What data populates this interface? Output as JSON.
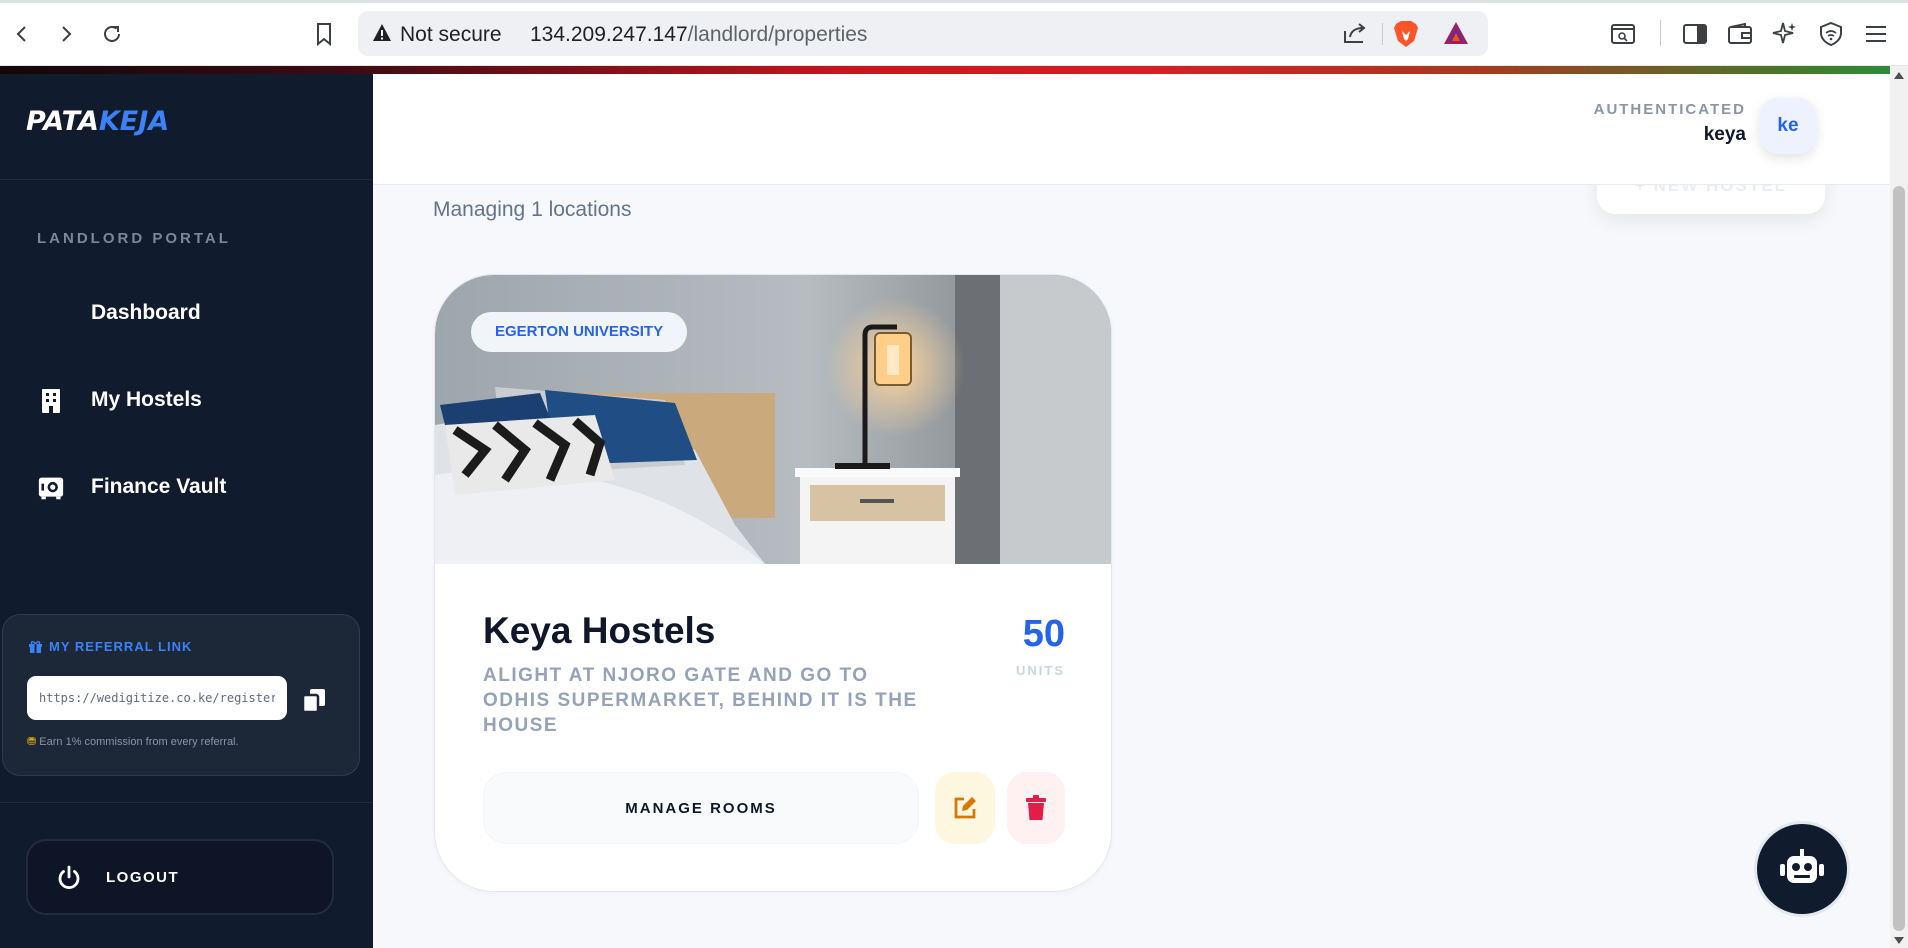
{
  "browser": {
    "security_text": "Not secure",
    "url_host": "134.209.247.147",
    "url_path": "/landlord/properties"
  },
  "sidebar": {
    "logo_part1": "PATA",
    "logo_part2": "KEJA",
    "portal_label": "LANDLORD PORTAL",
    "items": [
      {
        "label": "Dashboard",
        "icon": "dashboard-icon"
      },
      {
        "label": "My Hostels",
        "icon": "building-icon"
      },
      {
        "label": "Finance Vault",
        "icon": "vault-icon"
      }
    ],
    "referral": {
      "title": "MY REFERRAL LINK",
      "link_value": "https://wedigitize.co.ke/register?ref=keya",
      "note": "Earn 1% commission from every referral."
    },
    "logout_label": "LOGOUT"
  },
  "header": {
    "auth_label": "AUTHENTICATED",
    "username": "keya",
    "avatar_initials": "ke"
  },
  "main": {
    "add_button_label": "+ NEW HOSTEL",
    "managing_text": "Managing 1 locations",
    "properties": [
      {
        "badge": "EGERTON UNIVERSITY",
        "name": "Keya Hostels",
        "description": "ALIGHT AT NJORO GATE AND GO TO ODHIS SUPERMARKET, BEHIND IT IS THE HOUSE",
        "units": "50",
        "units_label": "UNITS",
        "manage_label": "MANAGE ROOMS"
      }
    ]
  },
  "colors": {
    "sidebar_bg": "#111b2e",
    "accent_blue": "#2563eb",
    "edit_orange": "#d97706",
    "delete_red": "#e11d48"
  }
}
